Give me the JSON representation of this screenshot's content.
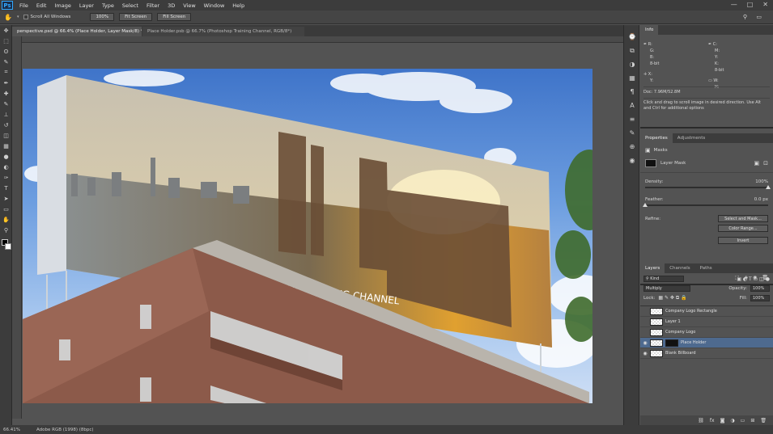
{
  "app": {
    "logo": "Ps"
  },
  "menu": [
    "File",
    "Edit",
    "Image",
    "Layer",
    "Type",
    "Select",
    "Filter",
    "3D",
    "View",
    "Window",
    "Help"
  ],
  "window_controls": [
    "—",
    "□",
    "✕"
  ],
  "options": {
    "scroll_all": "Scroll All Windows",
    "zoom": "100%",
    "fit_screen": "Fit Screen",
    "fill_screen": "Fill Screen"
  },
  "tabs": [
    "perspective.psd @ 66.4% (Place Holder, Layer Mask/8) *",
    "Place Holder.psb @ 66.7% (Photoshop Training Channel, RGB/8*)"
  ],
  "tools": [
    "move-icon",
    "marquee-icon",
    "lasso-icon",
    "quick-select-icon",
    "crop-icon",
    "eyedropper-icon",
    "healing-icon",
    "brush-icon",
    "stamp-icon",
    "history-brush-icon",
    "eraser-icon",
    "gradient-icon",
    "blur-icon",
    "dodge-icon",
    "pen-icon",
    "type-icon",
    "path-select-icon",
    "shape-icon",
    "hand-icon",
    "zoom-icon"
  ],
  "tool_glyphs": [
    "✥",
    "⬚",
    "ʘ",
    "✎",
    "⌗",
    "✒",
    "✚",
    "✎",
    "⊥",
    "↺",
    "◫",
    "▦",
    "●",
    "◐",
    "✑",
    "T",
    "➤",
    "▭",
    "✋",
    "⚲"
  ],
  "image_text": {
    "billboard_caption": "OP TRAINING CHANNEL"
  },
  "info": {
    "title": "Info",
    "r_label": "R:",
    "g_label": "G:",
    "b_label": "B:",
    "bits": "8-bit",
    "c_label": "C:",
    "m_label": "M:",
    "y_label": "Y:",
    "k_label": "K:",
    "x_label": "X:",
    "y2_label": "Y:",
    "w_label": "W:",
    "h_label": "H:",
    "doc": "Doc: 7.96M/52.8M",
    "hint": "Click and drag to scroll image in desired direction. Use Alt and Ctrl for additional options"
  },
  "properties": {
    "tabs": [
      "Properties",
      "Adjustments"
    ],
    "masks_label": "Masks",
    "layer_mask": "Layer Mask",
    "density_label": "Density:",
    "density_value": "100%",
    "density": 1.0,
    "feather_label": "Feather:",
    "feather_value": "0.0 px",
    "feather": 0.0,
    "refine_label": "Refine:",
    "select_and_mask": "Select and Mask...",
    "color_range": "Color Range...",
    "invert": "Invert"
  },
  "layers": {
    "tabs": [
      "Layers",
      "Channels",
      "Paths"
    ],
    "kind": "Kind",
    "blend_mode": "Multiply",
    "opacity_label": "Opacity:",
    "opacity": "100%",
    "lock_label": "Lock:",
    "fill_label": "Fill:",
    "fill": "100%",
    "items": [
      {
        "name": "Company Logo Rectangle",
        "visible": false,
        "selected": false
      },
      {
        "name": "Layer 1",
        "visible": false,
        "selected": false
      },
      {
        "name": "Company Logo",
        "visible": false,
        "selected": false
      },
      {
        "name": "Place Holder",
        "visible": true,
        "selected": true
      },
      {
        "name": "Blank Billboard",
        "visible": true,
        "selected": false
      }
    ]
  },
  "status": {
    "zoom": "66.41%",
    "profile": "Adobe RGB (1998) (8bpc)"
  },
  "colors": {
    "accent": "#31a8ff",
    "selection": "#4e6a8f"
  }
}
